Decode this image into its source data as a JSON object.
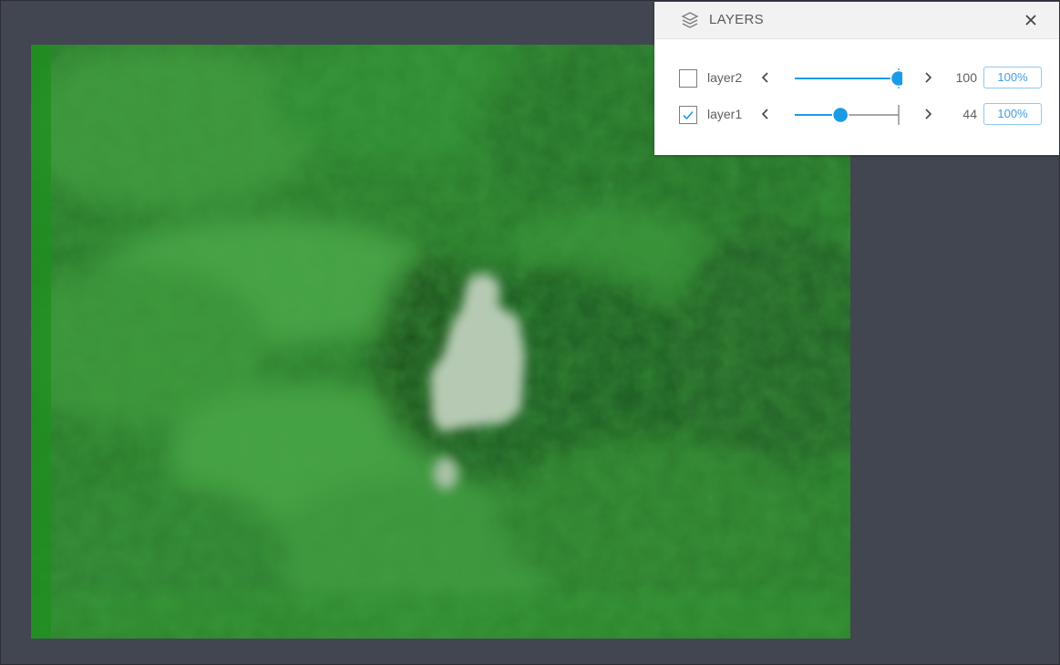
{
  "panel": {
    "title": "LAYERS",
    "icon": "layers-icon",
    "close_icon": "close-icon"
  },
  "layers": [
    {
      "name": "layer2",
      "checked": false,
      "value": 100,
      "value_text": "100",
      "opacity_label": "100%"
    },
    {
      "name": "layer1",
      "checked": true,
      "value": 44,
      "value_text": "44",
      "opacity_label": "100%"
    }
  ],
  "colors": {
    "accent": "#1a9be6",
    "background": "#414650",
    "panel": "#ffffff",
    "header": "#f2f2f2"
  }
}
